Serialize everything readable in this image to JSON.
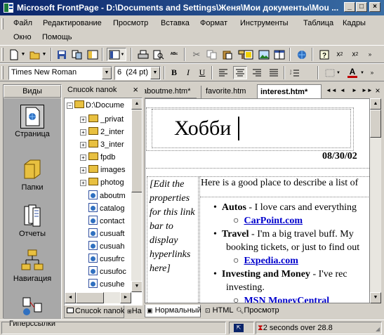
{
  "window": {
    "title": "Microsoft FrontPage - D:\\Documents and Settings\\Женя\\Мои документы\\Mou ..."
  },
  "menu": [
    "Файл",
    "Редактирование",
    "Просмотр",
    "Вставка",
    "Формат",
    "Инструменты",
    "Таблица",
    "Кадры",
    "Окно",
    "Помощь"
  ],
  "format": {
    "font": "Times New Roman",
    "size": "6  (24 pt)"
  },
  "views": {
    "header": "Виды",
    "items": [
      "Страница",
      "Папки",
      "Отчеты",
      "Навигация",
      "Гиперссылки"
    ]
  },
  "folders": {
    "header": "Cnucok nanok",
    "root": "D:\\Docume",
    "items": [
      "_privat",
      "2_inter",
      "3_inter",
      "fpdb",
      "images",
      "photog",
      "aboutm",
      "catalog",
      "contact",
      "cusuaft",
      "cusuah",
      "cusufrc",
      "cusufoc",
      "cusuhe"
    ],
    "bottom_tabs": [
      "Cnucok nanok",
      "Ha"
    ]
  },
  "tabs": [
    "aboutme.htm*",
    "favorite.htm",
    "interest.htm*"
  ],
  "page": {
    "heading": "Хобби",
    "date": "08/30/02",
    "linkbar": "[Edit the properties for this link bar to display hyperlinks here]",
    "intro": "Here is a good place to describe a list of",
    "items": [
      {
        "title": "Autos",
        "text": " - I love cars and everything",
        "link": "CarPoint.com"
      },
      {
        "title": "Travel",
        "text": " - I'm a big travel buff. My",
        "text2": "booking tickets, or just to find out",
        "link": "Expedia.com"
      },
      {
        "title": "Investing and Money",
        "text": " - I've rec",
        "text2": "investing.",
        "link": "MSN MoneyCentral"
      }
    ]
  },
  "view_tabs": [
    "Нормальный",
    "HTML",
    "Просмотр"
  ],
  "status": {
    "time": "2 seconds over 28.8"
  },
  "colors": {
    "link": "#0000cc",
    "title_bar": "#0a246a"
  }
}
